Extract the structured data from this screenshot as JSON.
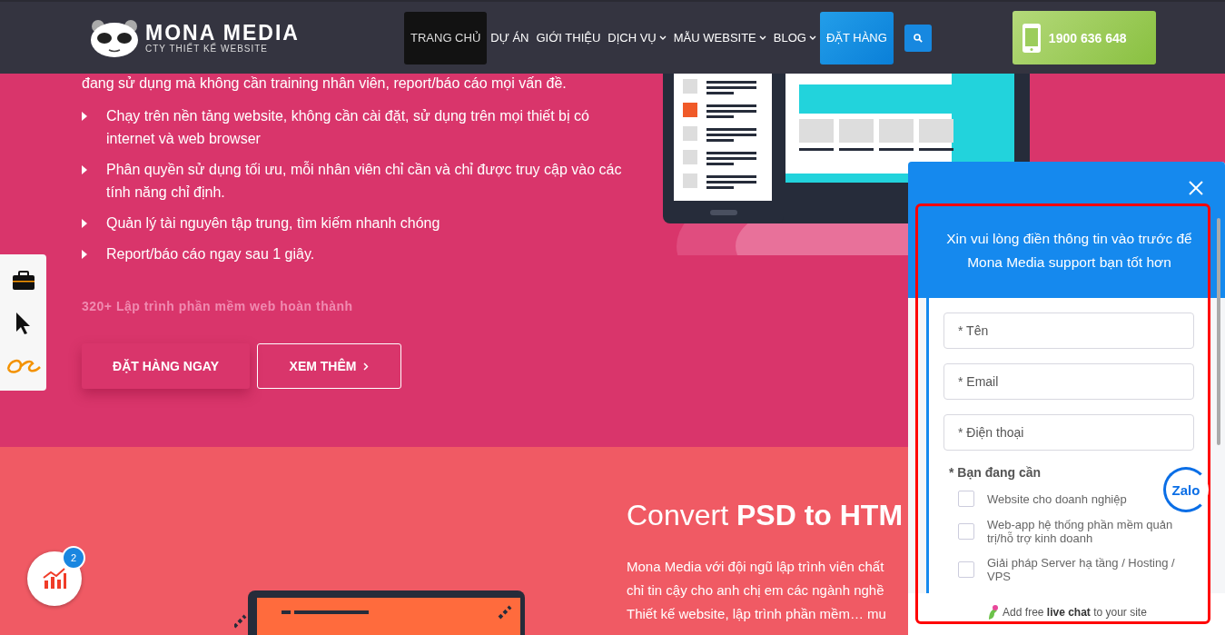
{
  "header": {
    "logo": {
      "name": "MONA MEDIA",
      "tagline": "CTY THIẾT KẾ WEBSITE"
    },
    "nav": [
      {
        "label": "TRANG CHỦ",
        "kind": "link",
        "selected": true,
        "has_menu": false
      },
      {
        "label": "DỰ ÁN",
        "kind": "link",
        "selected": false,
        "has_menu": false
      },
      {
        "label": "GIỚI THIỆU",
        "kind": "link",
        "selected": false,
        "has_menu": false
      },
      {
        "label": "DỊCH VỤ",
        "kind": "link",
        "selected": false,
        "has_menu": true
      },
      {
        "label": "MẪU WEBSITE",
        "kind": "link",
        "selected": false,
        "has_menu": true
      },
      {
        "label": "BLOG",
        "kind": "link",
        "selected": false,
        "has_menu": true
      },
      {
        "label": "ĐẶT HÀNG",
        "kind": "button",
        "selected": false,
        "has_menu": false
      }
    ],
    "phone": "1900 636 648"
  },
  "hero": {
    "intro": "đang sử dụng mà không cần training nhân viên, report/báo cáo mọi vấn đề.",
    "bullets": [
      "Chạy trên nền tảng website, không cần cài đặt, sử dụng trên mọi thiết bị có internet và web browser",
      "Phân quyền sử dụng tối ưu, mỗi nhân viên chỉ cần và chỉ được truy cập vào các tính năng chỉ định.",
      "Quản lý tài nguyên tập trung, tìm kiếm nhanh chóng",
      "Report/báo cáo ngay sau 1 giây."
    ],
    "stat": "320+ Lập trình phần mềm web hoàn thành",
    "primary_button": "ĐẶT HÀNG NGAY",
    "secondary_button": "XEM THÊM"
  },
  "section2": {
    "title": "Convert **PSD to HTM**",
    "lines": [
      "Mona Media với đội ngũ lập trình viên chất",
      "chỉ tin cậy cho anh chị em các ngành nghề",
      "Thiết kế website, lập trình phần mềm… mu"
    ]
  },
  "stats_button": {
    "badge": "2"
  },
  "chat_widget": {
    "title": "Xin vui lòng điền thông tin vào trước để Mona Media support bạn tốt hơn",
    "fields": [
      {
        "placeholder": "* Tên"
      },
      {
        "placeholder": "* Email"
      },
      {
        "placeholder": "* Điện thoại"
      }
    ],
    "need_label": "* Bạn đang cần",
    "options": [
      {
        "label": "Website cho doanh nghiệp",
        "checked": false
      },
      {
        "label": "Web-app hệ thống phần mềm quản trị/hỗ trợ kinh doanh",
        "checked": false
      },
      {
        "label": "Giải pháp Server hạ tầng / Hosting / VPS",
        "checked": false
      }
    ],
    "zalo": "Zalo",
    "footer": "Add free **live chat** to your site"
  }
}
